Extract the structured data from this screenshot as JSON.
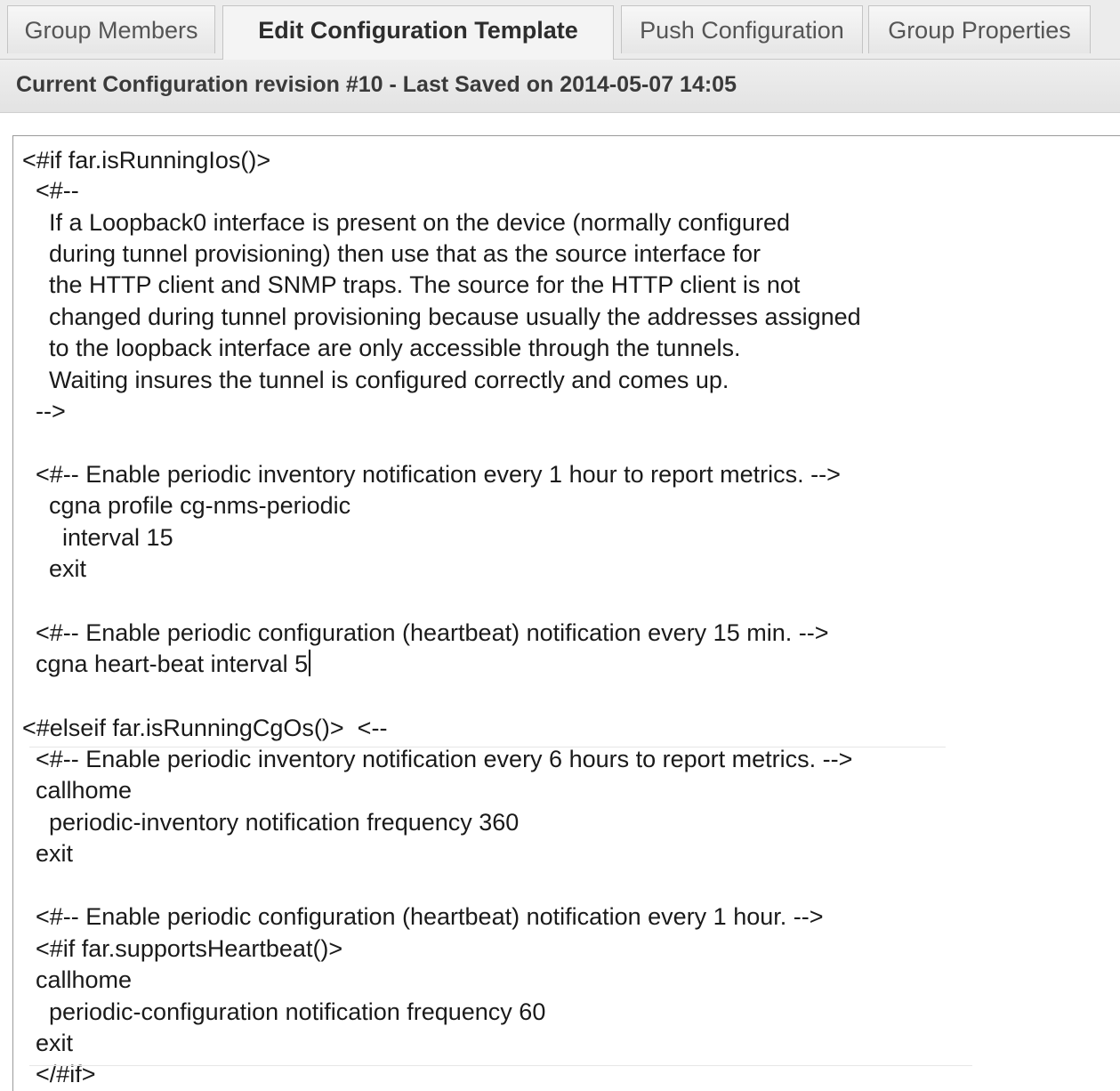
{
  "tabs": [
    {
      "label": "Group Members",
      "active": false
    },
    {
      "label": "Edit Configuration Template",
      "active": true
    },
    {
      "label": "Push Configuration",
      "active": false
    },
    {
      "label": "Group Properties",
      "active": false
    }
  ],
  "revision_header": "Current Configuration revision #10 - Last Saved on 2014-05-07 14:05",
  "editor": {
    "lines": [
      "<#if far.isRunningIos()>",
      "  <#--",
      "    If a Loopback0 interface is present on the device (normally configured",
      "    during tunnel provisioning) then use that as the source interface for",
      "    the HTTP client and SNMP traps. The source for the HTTP client is not",
      "    changed during tunnel provisioning because usually the addresses assigned",
      "    to the loopback interface are only accessible through the tunnels.",
      "    Waiting insures the tunnel is configured correctly and comes up.",
      "  -->",
      "",
      "  <#-- Enable periodic inventory notification every 1 hour to report metrics. -->",
      "    cgna profile cg-nms-periodic",
      "      interval 15",
      "    exit",
      "",
      "  <#-- Enable periodic configuration (heartbeat) notification every 15 min. -->",
      "  cgna heart-beat interval 5",
      "",
      "<#elseif far.isRunningCgOs()>  <--",
      "  <#-- Enable periodic inventory notification every 6 hours to report metrics. -->",
      "  callhome",
      "    periodic-inventory notification frequency 360",
      "  exit",
      "",
      "  <#-- Enable periodic configuration (heartbeat) notification every 1 hour. -->",
      "  <#if far.supportsHeartbeat()>",
      "  callhome",
      "    periodic-configuration notification frequency 60",
      "  exit",
      "  </#if>"
    ]
  }
}
